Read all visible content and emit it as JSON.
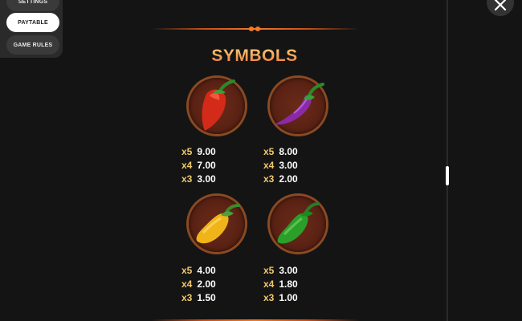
{
  "menu": {
    "items": [
      {
        "label": "SETTINGS",
        "active": false
      },
      {
        "label": "PAYTABLE",
        "active": true
      },
      {
        "label": "GAME RULES",
        "active": false
      }
    ]
  },
  "paytable": {
    "title": "SYMBOLS",
    "symbols": [
      {
        "icon": "red-pepper-icon",
        "color": "#d42a1a",
        "pays": [
          {
            "mult": "x5",
            "amount": "9.00"
          },
          {
            "mult": "x4",
            "amount": "7.00"
          },
          {
            "mult": "x3",
            "amount": "3.00"
          }
        ]
      },
      {
        "icon": "purple-pepper-icon",
        "color": "#8a2aa8",
        "pays": [
          {
            "mult": "x5",
            "amount": "8.00"
          },
          {
            "mult": "x4",
            "amount": "3.00"
          },
          {
            "mult": "x3",
            "amount": "2.00"
          }
        ]
      },
      {
        "icon": "yellow-pepper-icon",
        "color": "#f0b418",
        "pays": [
          {
            "mult": "x5",
            "amount": "4.00"
          },
          {
            "mult": "x4",
            "amount": "2.00"
          },
          {
            "mult": "x3",
            "amount": "1.50"
          }
        ]
      },
      {
        "icon": "green-pepper-icon",
        "color": "#2aa02a",
        "pays": [
          {
            "mult": "x5",
            "amount": "3.00"
          },
          {
            "mult": "x4",
            "amount": "1.80"
          },
          {
            "mult": "x3",
            "amount": "1.00"
          }
        ]
      }
    ]
  },
  "colors": {
    "accent_gold": "#f2c96a",
    "divider_orange": "#f07a2a",
    "background": "#141414"
  },
  "close_icon": "close-icon"
}
